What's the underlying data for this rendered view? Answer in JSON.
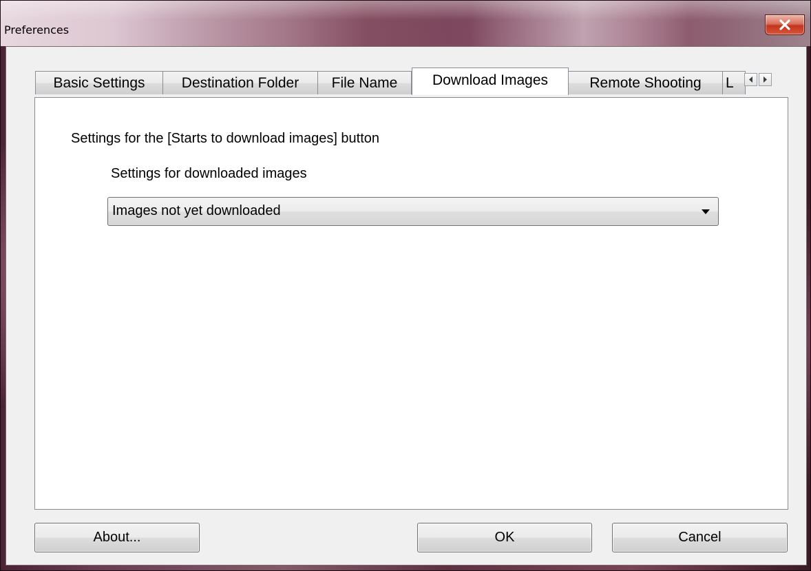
{
  "window": {
    "title": "Preferences",
    "close_label": "x"
  },
  "tabs": [
    {
      "label": "Basic Settings",
      "active": false
    },
    {
      "label": "Destination Folder",
      "active": false
    },
    {
      "label": "File Name",
      "active": false
    },
    {
      "label": "Download Images",
      "active": true
    },
    {
      "label": "Remote Shooting",
      "active": false
    },
    {
      "label": "L",
      "active": false
    }
  ],
  "tab_scroll": {
    "left_icon": "scroll-left-arrow-icon",
    "right_icon": "scroll-right-arrow-icon"
  },
  "panel": {
    "group_label": "Settings for the [Starts to download images] button",
    "sub_label": "Settings for downloaded images",
    "dropdown": {
      "selected": "Images not yet downloaded",
      "icon": "dropdown-arrow-icon"
    }
  },
  "buttons": {
    "about": "About...",
    "ok": "OK",
    "cancel": "Cancel"
  },
  "colors": {
    "close_button": "#c2351d",
    "panel_background": "#ffffff",
    "dialog_background": "#f0f0f0"
  }
}
